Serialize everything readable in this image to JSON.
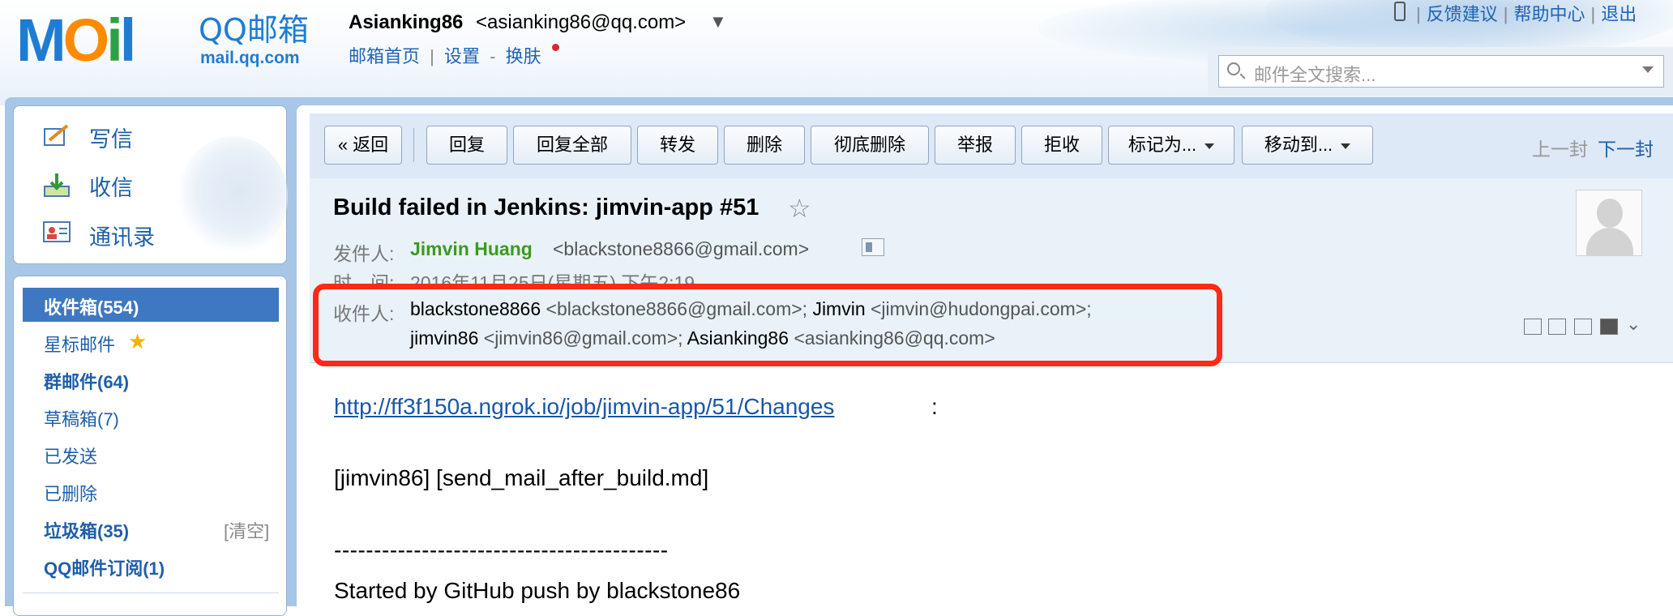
{
  "header": {
    "logo_text": "MOil",
    "brand": "QQ邮箱",
    "brand_sub": "mail.qq.com",
    "user_name": "Asianking86",
    "user_email": "<asianking86@qq.com>",
    "user_menu_arrow": "▼",
    "nav": [
      "邮箱首页",
      "|",
      "设置",
      "-",
      "换肤"
    ],
    "top_links": [
      "反馈建议",
      "帮助中心",
      "退出"
    ],
    "search_placeholder": "邮件全文搜索..."
  },
  "sidebar": {
    "actions": [
      {
        "label": "写信",
        "icon": "compose-icon"
      },
      {
        "label": "收信",
        "icon": "inbox-download-icon"
      },
      {
        "label": "通讯录",
        "icon": "contacts-icon"
      }
    ],
    "folders": [
      {
        "label": "收件箱(554)",
        "selected": true
      },
      {
        "label": "星标邮件",
        "icon": "star-icon"
      },
      {
        "label": "群邮件(64)"
      },
      {
        "label": "草稿箱(7)"
      },
      {
        "label": "已发送"
      },
      {
        "label": "已删除"
      },
      {
        "label": "垃圾箱(35)",
        "extra": "[清空]"
      },
      {
        "label": "QQ邮件订阅(1)"
      }
    ]
  },
  "toolbar": {
    "buttons": [
      "« 返回",
      "回复",
      "回复全部",
      "转发",
      "删除",
      "彻底删除",
      "举报",
      "拒收",
      "标记为...",
      "移动到..."
    ],
    "prev": "上一封",
    "next": "下一封"
  },
  "message": {
    "subject": "Build failed in Jenkins: jimvin-app #51",
    "from_label": "发件人:",
    "from_name": "Jimvin Huang",
    "from_email": "<blackstone8866@gmail.com>",
    "time_label": "时　间:",
    "time_value": "2016年11月25日(星期五) 下午2:19",
    "to_label": "收件人:",
    "recipients_line1": [
      {
        "name": "blackstone8866",
        "email": "<blackstone8866@gmail.com>;"
      },
      {
        "name": "Jimvin",
        "email": "<jimvin@hudongpai.com>;"
      }
    ],
    "recipients_line2": [
      {
        "name": "jimvin86",
        "email": "<jimvin86@gmail.com>;"
      },
      {
        "name": "Asianking86",
        "email": "<asianking86@qq.com>"
      }
    ],
    "body": {
      "link": "http://ff3f150a.ngrok.io/job/jimvin-app/51/Changes",
      "link_suffix": ":",
      "line1": "[jimvin86] [send_mail_after_build.md]",
      "dashes": "------------------------------------------",
      "line2": "Started by GitHub push by blackstone86"
    }
  },
  "colors": {
    "accent": "#1f63b5",
    "sender_green": "#3d9a1e",
    "highlight_red": "#ff2a14",
    "selected_folder": "#3f78c2"
  }
}
